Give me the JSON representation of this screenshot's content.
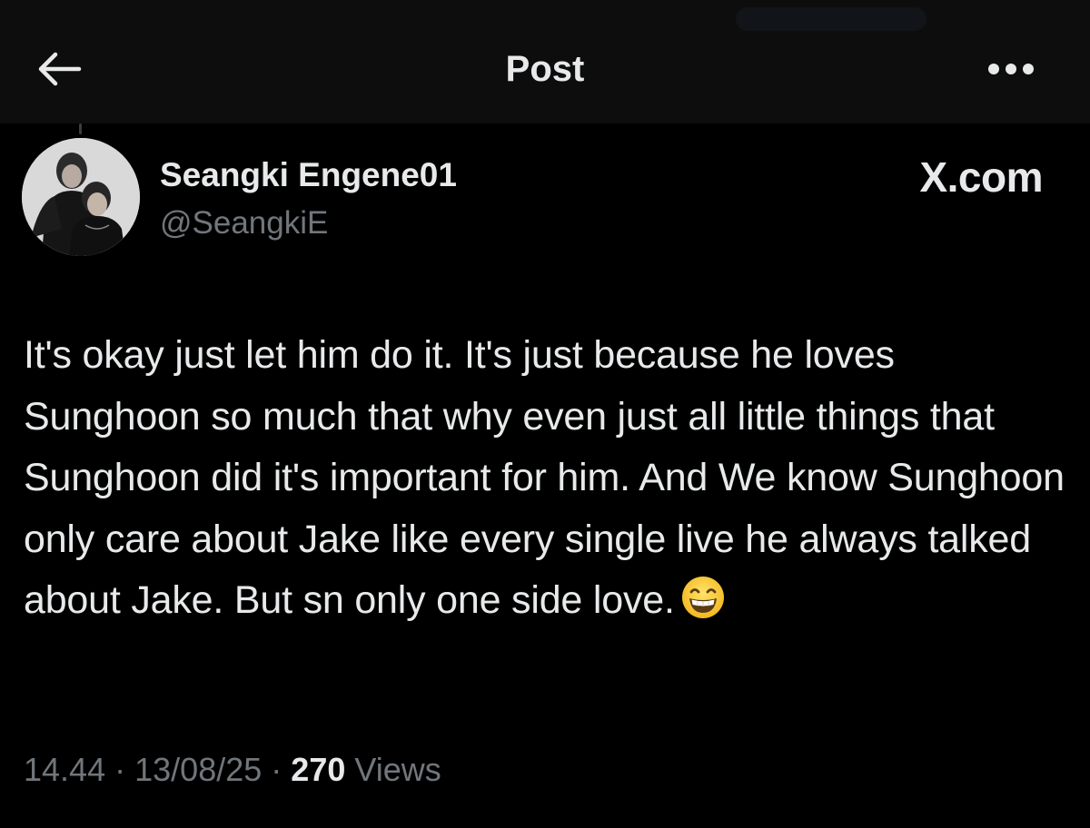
{
  "header": {
    "title": "Post",
    "back_icon": "arrow-left-icon",
    "more_icon": "more-horizontal-icon"
  },
  "author": {
    "display_name": "Seangki Engene01",
    "handle": "@SeangkiE",
    "avatar_icon": "avatar-photo"
  },
  "watermark": {
    "text": "X.com"
  },
  "post": {
    "text": "It's okay just let him do it. It's just because he loves Sunghoon so much that why even just all little things that Sunghoon did it's important for him. And We know Sunghoon only care about Jake like every single live he always talked about Jake. But sn only one side love.",
    "emoji": "😁",
    "emoji_icon": "grinning-face-emoji"
  },
  "meta": {
    "time": "14.44",
    "separator": "·",
    "date": "13/08/25",
    "views_count": "270",
    "views_label": "Views"
  },
  "colors": {
    "background": "#000000",
    "primary_text": "#e7e9ea",
    "secondary_text": "#71767b"
  }
}
